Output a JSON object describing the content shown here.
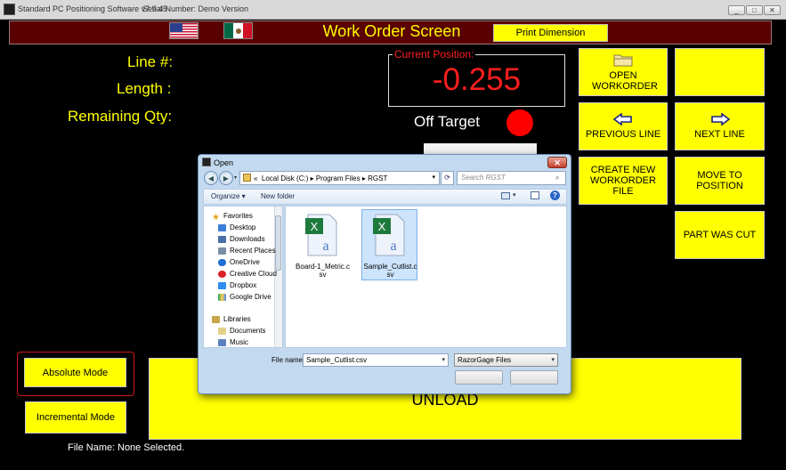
{
  "window": {
    "title": "Standard PC Positioning Software v7.9.45",
    "serial": "Serial Number: Demo Version",
    "controls": [
      "_",
      "□",
      "✕"
    ]
  },
  "header": {
    "title": "Work Order Screen",
    "print_dimension": "Print Dimension",
    "flags": [
      "united-states-flag",
      "mexico-flag"
    ]
  },
  "labels": {
    "line": "Line #:",
    "length": "Length :",
    "remaining": "Remaining Qty:"
  },
  "position": {
    "label": "Current Position:",
    "value": "-0.255",
    "status": "Off Target",
    "status_color": "#ff0000"
  },
  "buttons": {
    "open_workorder": "OPEN WORKORDER",
    "blank": "",
    "previous_line": "PREVIOUS LINE",
    "next_line": "NEXT LINE",
    "create_new": "CREATE NEW WORKORDER FILE",
    "move_to_position": "MOVE TO POSITION",
    "part_was_cut": "PART WAS CUT",
    "absolute_mode": "Absolute Mode",
    "incremental_mode": "Incremental Mode",
    "unload": "UNLOAD"
  },
  "footer": {
    "file_name_label": "File Name:",
    "file_name_value": "None Selected."
  },
  "colors": {
    "accent_yellow": "#ffff00",
    "header_bg": "#5a0000",
    "position_red": "#ff1e1e"
  },
  "dialog": {
    "title": "Open",
    "close": "✕",
    "breadcrumb_prefix": "«",
    "breadcrumb": [
      "Local Disk (C:)",
      "Program Files",
      "RGST"
    ],
    "breadcrumb_separator": "▸",
    "search_placeholder": "Search RGST",
    "toolbar": {
      "organize": "Organize ▾",
      "new_folder": "New folder"
    },
    "nav": {
      "favorites_header": "Favorites",
      "favorites": [
        "Desktop",
        "Downloads",
        "Recent Places",
        "OneDrive",
        "Creative Cloud",
        "Dropbox",
        "Google Drive"
      ],
      "libraries_header": "Libraries",
      "libraries": [
        "Documents",
        "Music"
      ]
    },
    "files": [
      {
        "name": "Board-1_Metric.csv",
        "selected": false
      },
      {
        "name": "Sample_Cutlist.csv",
        "selected": true
      }
    ],
    "file_name_label": "File name:",
    "file_name_value": "Sample_Cutlist.csv",
    "filter": "RazorGage Files"
  }
}
